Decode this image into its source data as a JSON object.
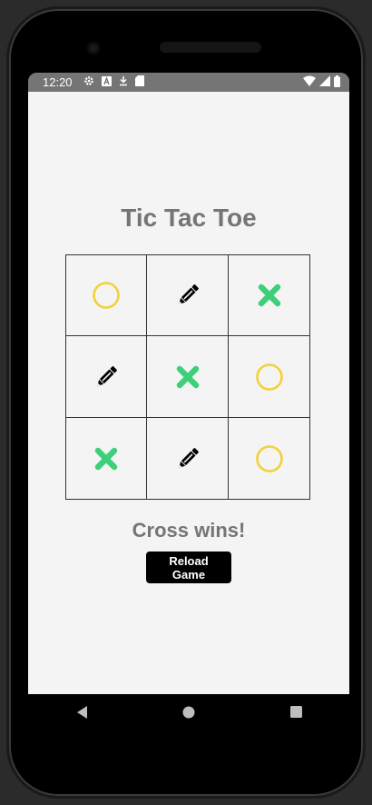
{
  "status_bar": {
    "time": "12:20",
    "left_icons": [
      "gear-icon",
      "a-notification-icon",
      "download-icon",
      "sd-card-icon"
    ],
    "right_icons": [
      "wifi-icon",
      "signal-icon",
      "battery-icon"
    ]
  },
  "app": {
    "title": "Tic Tac Toe",
    "result": "Cross wins!",
    "reload_label": "Reload Game"
  },
  "board": [
    [
      "circle",
      "pencil",
      "cross"
    ],
    [
      "pencil",
      "cross",
      "circle"
    ],
    [
      "cross",
      "pencil",
      "circle"
    ]
  ],
  "colors": {
    "circle": "#f2d13a",
    "cross": "#3ecf7a",
    "pencil": "#000000",
    "title": "#757575",
    "status_bar": "#757575"
  },
  "nav": [
    "back-icon",
    "home-icon",
    "recents-icon"
  ]
}
